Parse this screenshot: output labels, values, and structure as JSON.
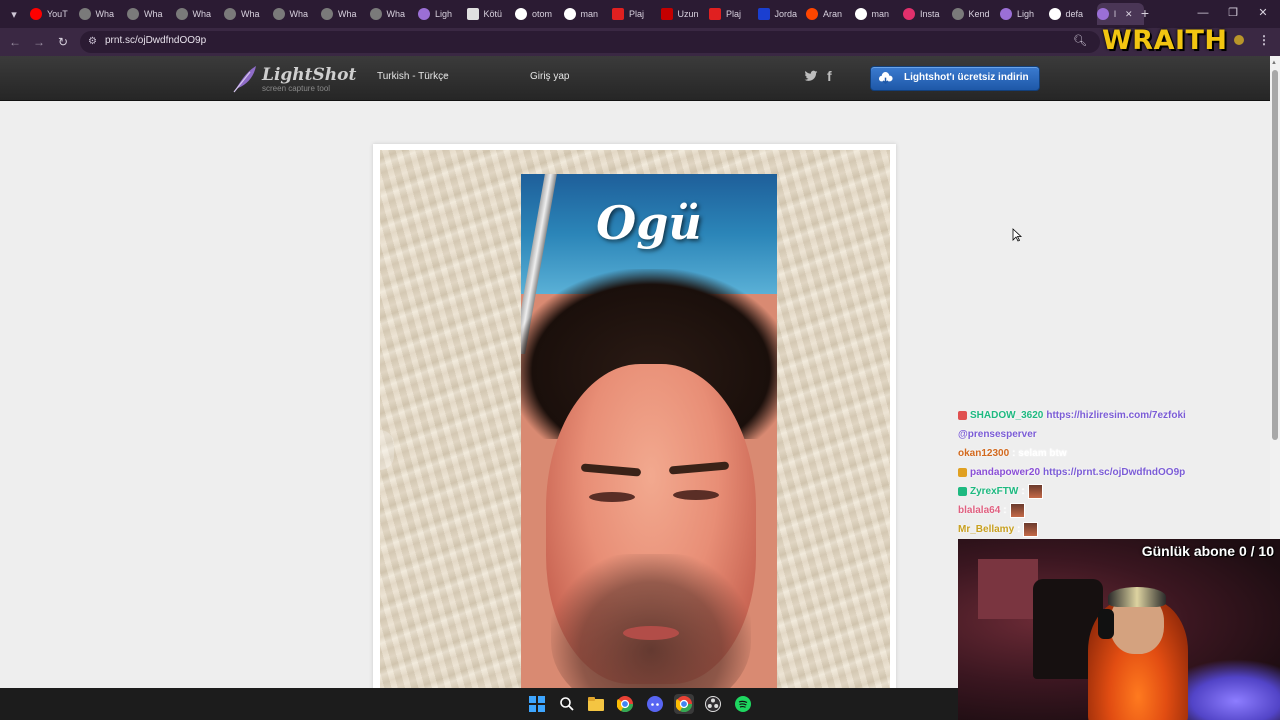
{
  "browser": {
    "tabs": [
      {
        "label": "YouT",
        "icon": "youtube-icon",
        "color": "#ff0000"
      },
      {
        "label": "Wha",
        "icon": "whatsapp-icon",
        "color": "#7a7a7a"
      },
      {
        "label": "Wha",
        "icon": "whatsapp-icon",
        "color": "#7a7a7a"
      },
      {
        "label": "Wha",
        "icon": "whatsapp-icon",
        "color": "#7a7a7a"
      },
      {
        "label": "Wha",
        "icon": "whatsapp-icon",
        "color": "#7a7a7a"
      },
      {
        "label": "Wha",
        "icon": "whatsapp-icon",
        "color": "#7a7a7a"
      },
      {
        "label": "Wha",
        "icon": "whatsapp-icon",
        "color": "#7a7a7a"
      },
      {
        "label": "Wha",
        "icon": "whatsapp-icon",
        "color": "#7a7a7a"
      },
      {
        "label": "Ligh",
        "icon": "lightshot-icon",
        "color": "#9b6fd6"
      },
      {
        "label": "Kötü",
        "icon": "gmail-icon",
        "color": "#e0e0e0"
      },
      {
        "label": "otom",
        "icon": "google-icon",
        "color": "#ffffff"
      },
      {
        "label": "man",
        "icon": "google-icon",
        "color": "#ffffff"
      },
      {
        "label": "Plaj",
        "icon": "pdf-icon",
        "color": "#e02020"
      },
      {
        "label": "Uzun",
        "icon": "marvel-icon",
        "color": "#c40000"
      },
      {
        "label": "Plaj",
        "icon": "pdf-icon",
        "color": "#e02020"
      },
      {
        "label": "Jorda",
        "icon": "site-icon",
        "color": "#1a3fd0"
      },
      {
        "label": "Aran",
        "icon": "reddit-icon",
        "color": "#ff4500"
      },
      {
        "label": "man",
        "icon": "google-icon",
        "color": "#ffffff"
      },
      {
        "label": "Insta",
        "icon": "instagram-icon",
        "color": "#e1306c"
      },
      {
        "label": "Kend",
        "icon": "whatsapp-icon",
        "color": "#7a7a7a"
      },
      {
        "label": "Ligh",
        "icon": "lightshot-icon",
        "color": "#9b6fd6"
      },
      {
        "label": "defa",
        "icon": "google-icon",
        "color": "#ffffff"
      },
      {
        "label": "l",
        "icon": "lightshot-icon",
        "color": "#9b6fd6",
        "active": true
      }
    ],
    "url": "prnt.sc/ojDwdfndOO9p",
    "overlay_logo": "WRAITH"
  },
  "lightshot": {
    "logo_name": "LightShot",
    "logo_tagline": "screen capture tool",
    "language": "Turkish - Türkçe",
    "login": "Giriş yap",
    "download_button": "Lightshot'ı ücretsiz indirin",
    "photo_caption": "Ogü"
  },
  "chat": {
    "messages": [
      {
        "user": "SHADOW_3620",
        "user_color": "#1eb980",
        "text": "https://hizliresim.com/7ezfoki",
        "text_color": "#7b5cd6",
        "badge": "#e05050"
      },
      {
        "user": "@prensesperver",
        "user_color": "#7b5cd6",
        "text": "",
        "text_color": "#7b5cd6",
        "badge": ""
      },
      {
        "user": "okan12300",
        "user_color": "#d2691e",
        "text": ": selam btw",
        "text_color": "#ffffff",
        "badge": ""
      },
      {
        "user": "pandapower20",
        "user_color": "#8a4fd6",
        "text": "https://prnt.sc/ojDwdfndOO9p",
        "text_color": "#7b5cd6",
        "badge": "#e0a020"
      },
      {
        "user": "ZyrexFTW",
        "user_color": "#1eb980",
        "text": ":",
        "text_color": "#ffffff",
        "badge": "#1eb980",
        "emote": true
      },
      {
        "user": "blalala64",
        "user_color": "#e06080",
        "text": ":",
        "text_color": "#ffffff",
        "badge": "",
        "emote": true
      },
      {
        "user": "Mr_Bellamy",
        "user_color": "#c8a020",
        "text": ":",
        "text_color": "#ffffff",
        "badge": "",
        "emote": true
      }
    ]
  },
  "webcam": {
    "sub_goal": "Günlük abone 0 / 10"
  },
  "taskbar": {
    "icons": [
      "windows-start-icon",
      "search-icon",
      "file-explorer-icon",
      "chrome-icon",
      "discord-icon",
      "chrome-icon",
      "obs-icon",
      "spotify-icon"
    ]
  }
}
